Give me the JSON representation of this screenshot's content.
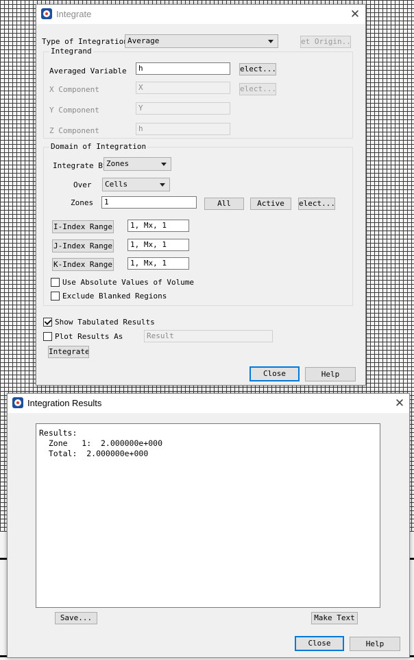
{
  "integrate_dialog": {
    "title": "Integrate",
    "type_label": "Type of Integration",
    "type_value": "Average",
    "set_origin": "et Origin..",
    "integrand": {
      "group_label": "Integrand",
      "averaged_variable_label": "Averaged Variable",
      "averaged_variable_value": "h",
      "select_label": "elect...",
      "x_label": "X Component",
      "x_value": "X",
      "x_select": "elect...",
      "y_label": "Y Component",
      "y_value": "Y",
      "z_label": "Z Component",
      "z_value": "h"
    },
    "domain": {
      "group_label": "Domain of Integration",
      "integrate_by_label": "Integrate By",
      "integrate_by_value": "Zones",
      "over_label": "Over",
      "over_value": "Cells",
      "zones_label": "Zones",
      "zones_value": "1",
      "all_button": "All",
      "active_button": "Active",
      "select_button": "elect...",
      "i_range_button": "I-Index Range",
      "i_range_value": "1, Mx, 1",
      "j_range_button": "J-Index Range",
      "j_range_value": "1, Mx, 1",
      "k_range_button": "K-Index Range",
      "k_range_value": "1, Mx, 1",
      "abs_volume_label": "Use Absolute Values of Volume",
      "abs_volume_checked": false,
      "exclude_blanked_label": "Exclude Blanked Regions",
      "exclude_blanked_checked": false
    },
    "show_tabulated_label": "Show Tabulated Results",
    "show_tabulated_checked": true,
    "plot_results_label": "Plot Results As",
    "plot_results_checked": false,
    "plot_results_placeholder": "Result",
    "integrate_button": "Integrate",
    "close_button": "Close",
    "help_button": "Help"
  },
  "results_dialog": {
    "title": "Integration Results",
    "results_text": "Results:\n  Zone   1:  2.000000e+000\n  Total:  2.000000e+000",
    "save_button": "Save...",
    "make_text_button": "Make Text",
    "close_button": "Close",
    "help_button": "Help"
  },
  "colors": {
    "focus_border": "#0078d7",
    "dialog_bg": "#f0f0f0",
    "grid_lines": "#3a3a3a"
  }
}
